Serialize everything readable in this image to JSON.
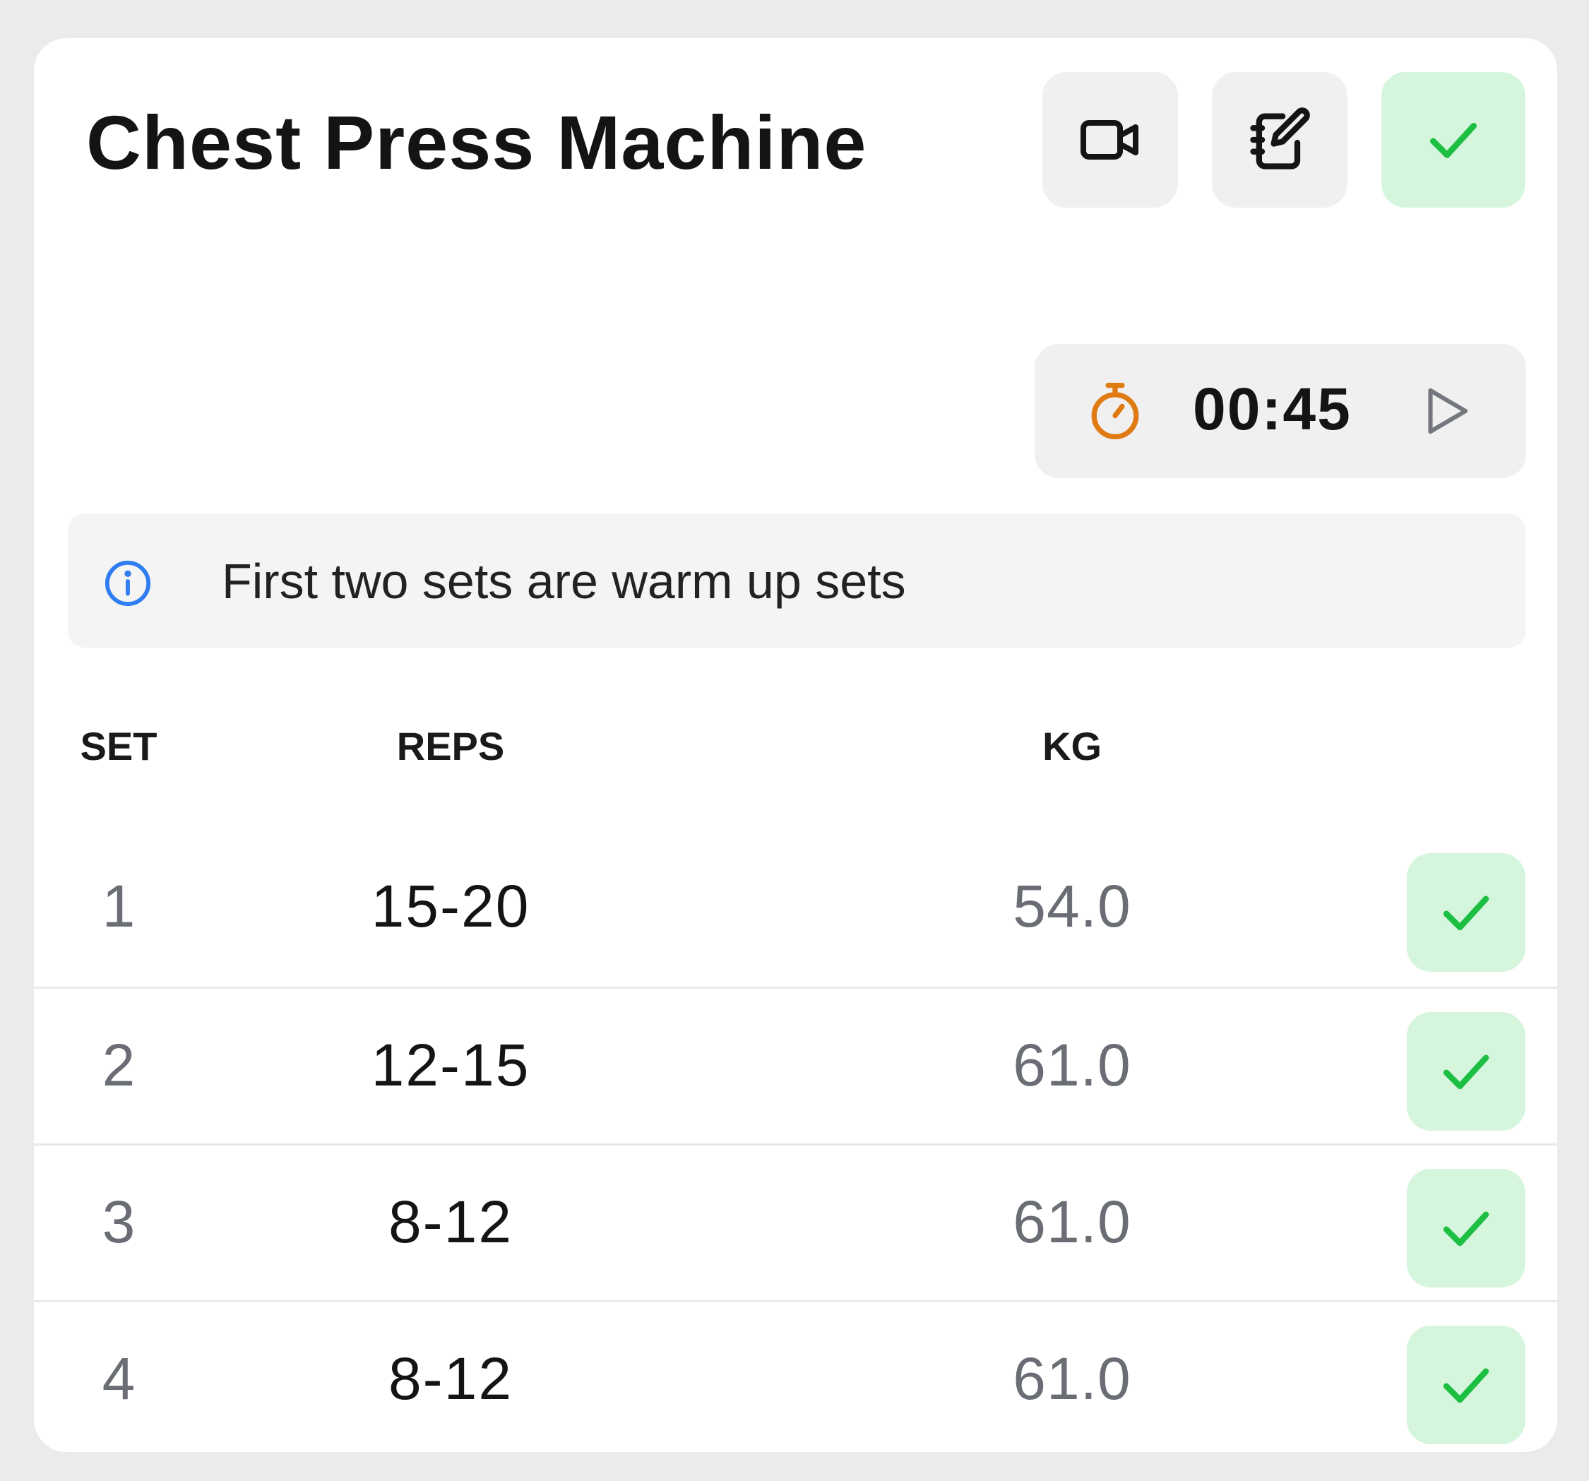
{
  "exercise": {
    "title": "Chest Press Machine"
  },
  "toolbar": {
    "video_icon": "video-camera-icon",
    "notes_icon": "notebook-edit-icon",
    "complete_icon": "checkmark-icon"
  },
  "timer": {
    "value": "00:45",
    "icon": "stopwatch-icon",
    "action_icon": "play-icon"
  },
  "note": {
    "icon": "info-icon",
    "text": "First two sets are warm up sets"
  },
  "table": {
    "headers": {
      "set": "SET",
      "reps": "REPS",
      "kg": "KG"
    },
    "rows": [
      {
        "set": "1",
        "reps": "15-20",
        "kg": "54.0",
        "completed": true
      },
      {
        "set": "2",
        "reps": "12-15",
        "kg": "61.0",
        "completed": true
      },
      {
        "set": "3",
        "reps": "8-12",
        "kg": "61.0",
        "completed": true
      },
      {
        "set": "4",
        "reps": "8-12",
        "kg": "61.0",
        "completed": true
      }
    ]
  },
  "colors": {
    "accent_green": "#1dbf43",
    "green_bg": "#d5f5dc",
    "timer_orange": "#e07a12",
    "info_blue": "#2f7df0"
  }
}
